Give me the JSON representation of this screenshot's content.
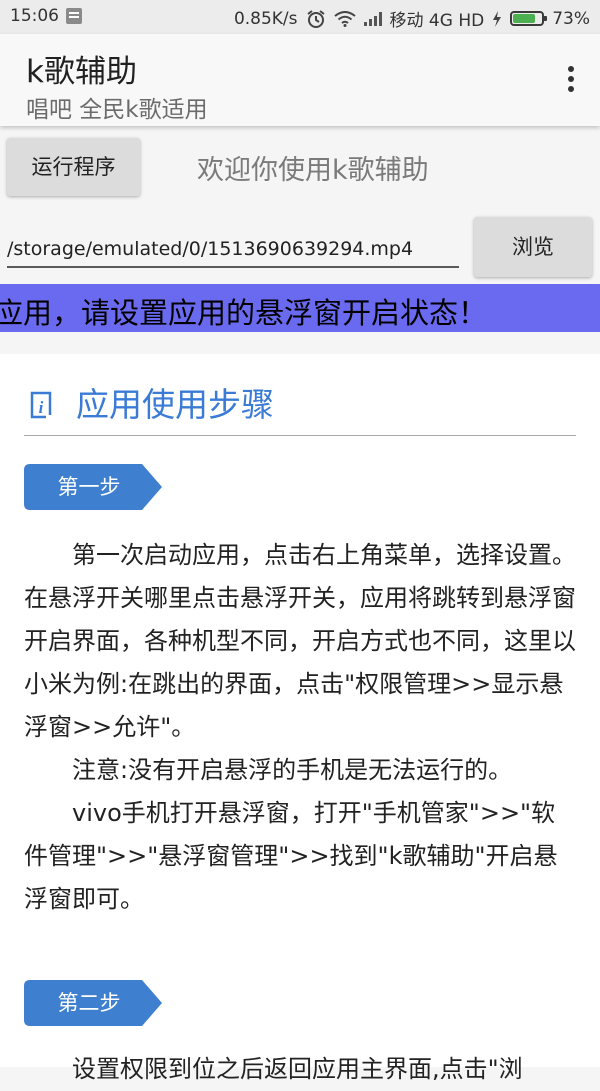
{
  "status_bar": {
    "time": "15:06",
    "network_speed": "0.85K/s",
    "carrier": "移动 4G HD",
    "battery_percent": "73%",
    "battery_level": 0.73
  },
  "app_bar": {
    "title": "k歌辅助",
    "subtitle": "唱吧 全民k歌适用"
  },
  "controls": {
    "run_label": "运行程序",
    "welcome": "欢迎你使用k歌辅助",
    "file_path": "/storage/emulated/0/1513690639294.mp4",
    "browse_label": "浏览"
  },
  "marquee": {
    "text": "应用，请设置应用的悬浮窗开启状态！"
  },
  "guide": {
    "title": "应用使用步骤",
    "steps": [
      {
        "label": "第一步",
        "paragraphs": [
          "第一次启动应用，点击右上角菜单，选择设置。在悬浮开关哪里点击悬浮开关，应用将跳转到悬浮窗开启界面，各种机型不同，开启方式也不同，这里以小米为例:在跳出的界面，点击\"权限管理>>显示悬浮窗>>允许\"。",
          "注意:没有开启悬浮的手机是无法运行的。",
          "vivo手机打开悬浮窗，打开\"手机管家\">>\"软件管理\">>\"悬浮窗管理\">>找到\"k歌辅助\"开启悬浮窗即可。"
        ]
      },
      {
        "label": "第二步",
        "paragraphs": [
          "设置权限到位之后返回应用主界面,点击\"浏"
        ]
      }
    ]
  },
  "colors": {
    "accent": "#3a7bd5",
    "marquee_bg": "#6a6af0",
    "step_tag": "#3f7fd0"
  }
}
